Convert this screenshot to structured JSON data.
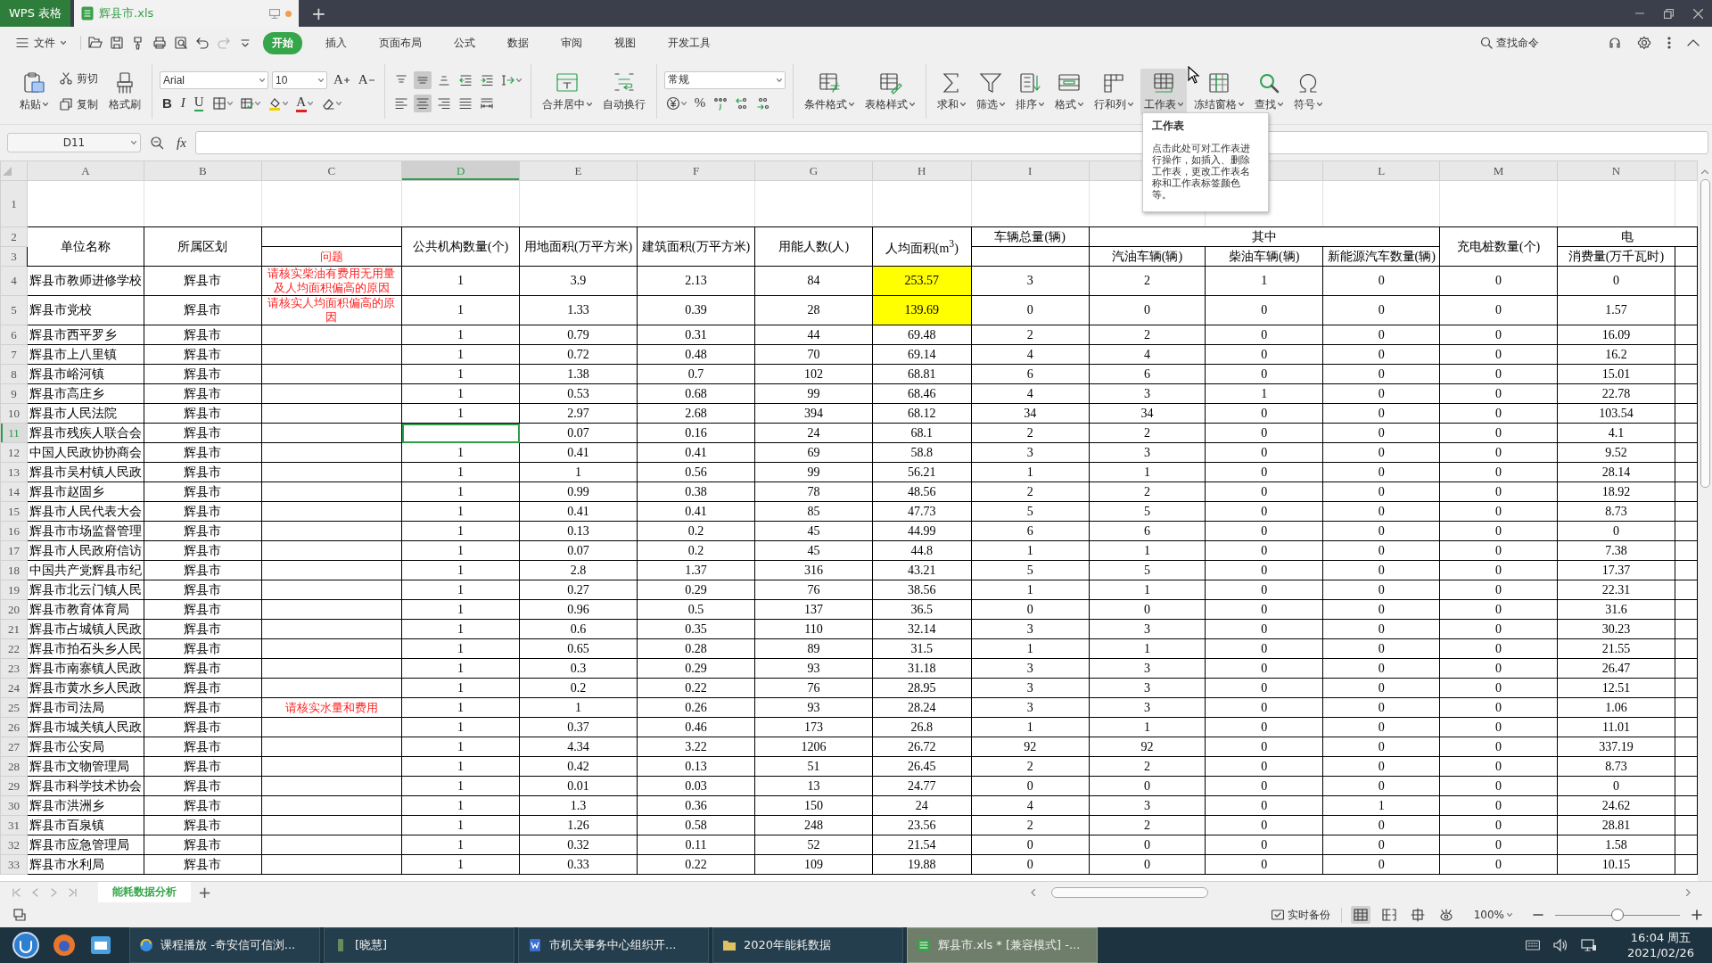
{
  "title_bar": {
    "app": "WPS 表格",
    "tabs": [
      {
        "label": "辉县市.xls",
        "selected": true,
        "unsaved": true
      }
    ],
    "new_tab": "+"
  },
  "menu_bar": {
    "file": "文件",
    "quick_access": [
      {
        "disabled": false
      },
      {
        "disabled": false
      },
      {
        "disabled": false
      },
      {
        "disabled": false
      },
      {
        "disabled": false
      },
      {
        "disabled": false
      },
      {
        "disabled": true
      },
      {
        "disabled": false
      }
    ],
    "tabs": [
      {
        "label": "开始",
        "selected": true
      },
      {
        "label": "插入",
        "selected": false
      },
      {
        "label": "页面布局",
        "selected": false
      },
      {
        "label": "公式",
        "selected": false
      },
      {
        "label": "数据",
        "selected": false
      },
      {
        "label": "审阅",
        "selected": false
      },
      {
        "label": "视图",
        "selected": false
      },
      {
        "label": "开发工具",
        "selected": false
      }
    ],
    "search": "查找命令"
  },
  "ribbon": {
    "groups": [
      {
        "kind": "mixed",
        "items": [
          {
            "kind": "large",
            "label": "粘贴",
            "dropdown": true,
            "hovered": false
          },
          {
            "kind": "small",
            "label": "剪切"
          },
          {
            "kind": "small",
            "label": "复制"
          },
          {
            "kind": "large",
            "label": "格式刷",
            "dropdown": false,
            "hovered": false
          }
        ]
      },
      {
        "kind": "grid",
        "rows": [
          [
            {
              "kind": "select",
              "value": "Arial"
            },
            {
              "kind": "select",
              "value": "10"
            },
            {
              "kind": "glyph",
              "glyph": "A",
              "selected": false,
              "dropdown": false
            },
            {
              "kind": "glyph",
              "glyph": "A",
              "selected": false,
              "dropdown": false
            }
          ],
          [
            {
              "kind": "glyph",
              "glyph": "B",
              "selected": false,
              "dropdown": false
            },
            {
              "kind": "glyph",
              "glyph": "I",
              "selected": false,
              "dropdown": false
            },
            {
              "kind": "glyph",
              "glyph": "U",
              "selected": false,
              "dropdown": false
            },
            {
              "kind": "tool",
              "selected": false,
              "dropdown": true
            },
            {
              "kind": "tool",
              "selected": false,
              "dropdown": true
            },
            {
              "kind": "tool",
              "selected": false,
              "dropdown": true
            },
            {
              "kind": "glyph",
              "glyph": "A",
              "selected": false,
              "dropdown": true
            },
            {
              "kind": "tool",
              "selected": false,
              "dropdown": true
            }
          ]
        ]
      },
      {
        "kind": "grid",
        "rows": [
          [
            {
              "kind": "tool",
              "selected": false,
              "dropdown": false
            },
            {
              "kind": "tool",
              "selected": true,
              "dropdown": false
            },
            {
              "kind": "tool",
              "selected": false,
              "dropdown": false
            },
            {
              "kind": "tool",
              "selected": false,
              "dropdown": false
            },
            {
              "kind": "tool",
              "selected": false,
              "dropdown": false
            },
            {
              "kind": "tool",
              "selected": false,
              "dropdown": true
            }
          ],
          [
            {
              "kind": "tool",
              "selected": false,
              "dropdown": false
            },
            {
              "kind": "tool",
              "selected": true,
              "dropdown": false
            },
            {
              "kind": "tool",
              "selected": false,
              "dropdown": false
            },
            {
              "kind": "tool",
              "selected": false,
              "dropdown": false
            },
            {
              "kind": "tool",
              "selected": false,
              "dropdown": false
            }
          ]
        ]
      },
      {
        "kind": "mixed",
        "items": [
          {
            "kind": "large",
            "label": "合并居中",
            "dropdown": true,
            "hovered": false
          },
          {
            "kind": "large",
            "label": "自动换行",
            "dropdown": false,
            "hovered": false
          }
        ]
      },
      {
        "kind": "grid",
        "rows": [
          [
            {
              "kind": "select",
              "value": "常规"
            }
          ],
          [
            {
              "kind": "tool",
              "selected": false,
              "dropdown": true
            },
            {
              "kind": "glyph",
              "glyph": "%",
              "selected": false,
              "dropdown": false
            },
            {
              "kind": "tool",
              "selected": false,
              "dropdown": false
            },
            {
              "kind": "tool",
              "selected": false,
              "dropdown": false
            },
            {
              "kind": "tool",
              "selected": false,
              "dropdown": false
            }
          ]
        ]
      },
      {
        "kind": "mixed",
        "items": [
          {
            "kind": "large",
            "label": "条件格式",
            "dropdown": true,
            "hovered": false
          },
          {
            "kind": "large",
            "label": "表格样式",
            "dropdown": true,
            "hovered": false
          }
        ]
      },
      {
        "kind": "mixed",
        "items": [
          {
            "kind": "large",
            "label": "求和",
            "dropdown": true,
            "hovered": false
          },
          {
            "kind": "large",
            "label": "筛选",
            "dropdown": true,
            "hovered": false
          },
          {
            "kind": "large",
            "label": "排序",
            "dropdown": true,
            "hovered": false
          },
          {
            "kind": "large",
            "label": "格式",
            "dropdown": true,
            "hovered": false
          },
          {
            "kind": "large",
            "label": "行和列",
            "dropdown": true,
            "hovered": false
          },
          {
            "kind": "large",
            "label": "工作表",
            "dropdown": true,
            "hovered": true
          },
          {
            "kind": "large",
            "label": "冻结窗格",
            "dropdown": true,
            "hovered": false
          },
          {
            "kind": "large",
            "label": "查找",
            "dropdown": true,
            "hovered": false
          },
          {
            "kind": "large",
            "label": "符号",
            "dropdown": true,
            "hovered": false
          }
        ]
      }
    ]
  },
  "tooltip": {
    "title": "工作表",
    "body": "点击此处可对工作表进行操作，如插入、删除工作表，更改工作表名称和工作表标签颜色等。"
  },
  "formula_bar": {
    "name_box": "D11",
    "fx": "fx"
  },
  "sheet": {
    "columns": [
      {
        "letter": "A",
        "selected": false
      },
      {
        "letter": "B",
        "selected": false
      },
      {
        "letter": "C",
        "selected": false
      },
      {
        "letter": "D",
        "selected": true
      },
      {
        "letter": "E",
        "selected": false
      },
      {
        "letter": "F",
        "selected": false
      },
      {
        "letter": "G",
        "selected": false
      },
      {
        "letter": "H",
        "selected": false
      },
      {
        "letter": "I",
        "selected": false
      },
      {
        "selected": false
      },
      {
        "selected": false
      },
      {
        "letter": "L",
        "selected": false
      },
      {
        "letter": "M",
        "selected": false
      },
      {
        "letter": "N",
        "selected": false
      },
      {
        "selected": false
      }
    ],
    "blank_row": {
      "number": "1"
    },
    "header_rows": [
      {
        "number": "2",
        "cells": [
          {
            "text": "单位名称",
            "rowspan": 2
          },
          {
            "text": "所属区划",
            "rowspan": 2
          },
          {},
          {
            "text": "公共机构数量(个)",
            "rowspan": 2
          },
          {
            "text": "用地面积(万平方米)",
            "rowspan": 2
          },
          {
            "text": "建筑面积(万平方米)",
            "rowspan": 2
          },
          {
            "text": "用能人数(人)",
            "rowspan": 2
          },
          {
            "text": "人均面积(m$^{3}$)",
            "rowspan": 2
          },
          {
            "text": "车辆总量(辆)"
          },
          {
            "text": "其中",
            "colspan": 3
          },
          {
            "text": "充电桩数量(个)",
            "rowspan": 2
          },
          {
            "text": "电",
            "colspan": 2
          }
        ]
      },
      {
        "number": "3",
        "cells": [
          {
            "text": "问题",
            "kind": "note"
          },
          {},
          {
            "text": "汽油车辆(辆)"
          },
          {
            "text": "柴油车辆(辆)"
          },
          {
            "text": "新能源汽车数量(辆)"
          },
          {
            "text": "消费量(万千瓦时)"
          },
          {}
        ]
      }
    ],
    "rows": [
      {
        "number": "4",
        "name": "辉县市教师进修学校",
        "district": "辉县市",
        "note": "请核实柴油有费用无用量及人均面积偏高的原因",
        "values": [
          "1",
          "3.9",
          "2.13",
          "84",
          "253.57",
          "3",
          "2",
          "1",
          "0",
          "0",
          "0"
        ],
        "flagged": true,
        "selected": false
      },
      {
        "number": "5",
        "name": "辉县市党校",
        "district": "辉县市",
        "note": "请核实人均面积偏高的原因",
        "values": [
          "1",
          "1.33",
          "0.39",
          "28",
          "139.69",
          "0",
          "0",
          "0",
          "0",
          "0",
          "1.57"
        ],
        "flagged": true,
        "selected": false
      },
      {
        "number": "6",
        "name": "辉县市西平罗乡",
        "district": "辉县市",
        "values": [
          "1",
          "0.79",
          "0.31",
          "44",
          "69.48",
          "2",
          "2",
          "0",
          "0",
          "0",
          "16.09"
        ],
        "flagged": false,
        "selected": false
      },
      {
        "number": "7",
        "name": "辉县市上八里镇",
        "district": "辉县市",
        "values": [
          "1",
          "0.72",
          "0.48",
          "70",
          "69.14",
          "4",
          "4",
          "0",
          "0",
          "0",
          "16.2"
        ],
        "flagged": false,
        "selected": false
      },
      {
        "number": "8",
        "name": "辉县市峪河镇",
        "district": "辉县市",
        "values": [
          "1",
          "1.38",
          "0.7",
          "102",
          "68.81",
          "6",
          "6",
          "0",
          "0",
          "0",
          "15.01"
        ],
        "flagged": false,
        "selected": false
      },
      {
        "number": "9",
        "name": "辉县市高庄乡",
        "district": "辉县市",
        "values": [
          "1",
          "0.53",
          "0.68",
          "99",
          "68.46",
          "4",
          "3",
          "1",
          "0",
          "0",
          "22.78"
        ],
        "flagged": false,
        "selected": false
      },
      {
        "number": "10",
        "name": "辉县市人民法院",
        "district": "辉县市",
        "values": [
          "1",
          "2.97",
          "2.68",
          "394",
          "68.12",
          "34",
          "34",
          "0",
          "0",
          "0",
          "103.54"
        ],
        "flagged": false,
        "selected": false
      },
      {
        "number": "11",
        "name": "辉县市残疾人联合会",
        "district": "辉县市",
        "values": [
          "0.07",
          "0.16",
          "24",
          "68.1",
          "2",
          "2",
          "0",
          "0",
          "0",
          "4.1"
        ],
        "flagged": false,
        "selected": true
      },
      {
        "number": "12",
        "name": "中国人民政协协商会",
        "district": "辉县市",
        "values": [
          "1",
          "0.41",
          "0.41",
          "69",
          "58.8",
          "3",
          "3",
          "0",
          "0",
          "0",
          "9.52"
        ],
        "flagged": false,
        "selected": false
      },
      {
        "number": "13",
        "name": "辉县市吴村镇人民政",
        "district": "辉县市",
        "values": [
          "1",
          "1",
          "0.56",
          "99",
          "56.21",
          "1",
          "1",
          "0",
          "0",
          "0",
          "28.14"
        ],
        "flagged": false,
        "selected": false
      },
      {
        "number": "14",
        "name": "辉县市赵固乡",
        "district": "辉县市",
        "values": [
          "1",
          "0.99",
          "0.38",
          "78",
          "48.56",
          "2",
          "2",
          "0",
          "0",
          "0",
          "18.92"
        ],
        "flagged": false,
        "selected": false
      },
      {
        "number": "15",
        "name": "辉县市人民代表大会",
        "district": "辉县市",
        "values": [
          "1",
          "0.41",
          "0.41",
          "85",
          "47.73",
          "5",
          "5",
          "0",
          "0",
          "0",
          "8.73"
        ],
        "flagged": false,
        "selected": false
      },
      {
        "number": "16",
        "name": "辉县市市场监督管理",
        "district": "辉县市",
        "values": [
          "1",
          "0.13",
          "0.2",
          "45",
          "44.99",
          "6",
          "6",
          "0",
          "0",
          "0",
          "0"
        ],
        "flagged": false,
        "selected": false
      },
      {
        "number": "17",
        "name": "辉县市人民政府信访",
        "district": "辉县市",
        "values": [
          "1",
          "0.07",
          "0.2",
          "45",
          "44.8",
          "1",
          "1",
          "0",
          "0",
          "0",
          "7.38"
        ],
        "flagged": false,
        "selected": false
      },
      {
        "number": "18",
        "name": "中国共产党辉县市纪",
        "district": "辉县市",
        "values": [
          "1",
          "2.8",
          "1.37",
          "316",
          "43.21",
          "5",
          "5",
          "0",
          "0",
          "0",
          "17.37"
        ],
        "flagged": false,
        "selected": false
      },
      {
        "number": "19",
        "name": "辉县市北云门镇人民",
        "district": "辉县市",
        "values": [
          "1",
          "0.27",
          "0.29",
          "76",
          "38.56",
          "1",
          "1",
          "0",
          "0",
          "0",
          "22.31"
        ],
        "flagged": false,
        "selected": false
      },
      {
        "number": "20",
        "name": "辉县市教育体育局",
        "district": "辉县市",
        "values": [
          "1",
          "0.96",
          "0.5",
          "137",
          "36.5",
          "0",
          "0",
          "0",
          "0",
          "0",
          "31.6"
        ],
        "flagged": false,
        "selected": false
      },
      {
        "number": "21",
        "name": "辉县市占城镇人民政",
        "district": "辉县市",
        "values": [
          "1",
          "0.6",
          "0.35",
          "110",
          "32.14",
          "3",
          "3",
          "0",
          "0",
          "0",
          "30.23"
        ],
        "flagged": false,
        "selected": false
      },
      {
        "number": "22",
        "name": "辉县市拍石头乡人民",
        "district": "辉县市",
        "values": [
          "1",
          "0.65",
          "0.28",
          "89",
          "31.5",
          "1",
          "1",
          "0",
          "0",
          "0",
          "21.55"
        ],
        "flagged": false,
        "selected": false
      },
      {
        "number": "23",
        "name": "辉县市南寨镇人民政",
        "district": "辉县市",
        "values": [
          "1",
          "0.3",
          "0.29",
          "93",
          "31.18",
          "3",
          "3",
          "0",
          "0",
          "0",
          "26.47"
        ],
        "flagged": false,
        "selected": false
      },
      {
        "number": "24",
        "name": "辉县市黄水乡人民政",
        "district": "辉县市",
        "values": [
          "1",
          "0.2",
          "0.22",
          "76",
          "28.95",
          "3",
          "3",
          "0",
          "0",
          "0",
          "12.51"
        ],
        "flagged": false,
        "selected": false
      },
      {
        "number": "25",
        "name": "辉县市司法局",
        "district": "辉县市",
        "note": "请核实水量和费用",
        "values": [
          "1",
          "1",
          "0.26",
          "93",
          "28.24",
          "3",
          "3",
          "0",
          "0",
          "0",
          "1.06"
        ],
        "flagged": false,
        "selected": false
      },
      {
        "number": "26",
        "name": "辉县市城关镇人民政",
        "district": "辉县市",
        "values": [
          "1",
          "0.37",
          "0.46",
          "173",
          "26.8",
          "1",
          "1",
          "0",
          "0",
          "0",
          "11.01"
        ],
        "flagged": false,
        "selected": false
      },
      {
        "number": "27",
        "name": "辉县市公安局",
        "district": "辉县市",
        "values": [
          "1",
          "4.34",
          "3.22",
          "1206",
          "26.72",
          "92",
          "92",
          "0",
          "0",
          "0",
          "337.19"
        ],
        "flagged": false,
        "selected": false
      },
      {
        "number": "28",
        "name": "辉县市文物管理局",
        "district": "辉县市",
        "values": [
          "1",
          "0.42",
          "0.13",
          "51",
          "26.45",
          "2",
          "2",
          "0",
          "0",
          "0",
          "8.73"
        ],
        "flagged": false,
        "selected": false
      },
      {
        "number": "29",
        "name": "辉县市科学技术协会",
        "district": "辉县市",
        "values": [
          "1",
          "0.01",
          "0.03",
          "13",
          "24.77",
          "0",
          "0",
          "0",
          "0",
          "0",
          "0"
        ],
        "flagged": false,
        "selected": false
      },
      {
        "number": "30",
        "name": "辉县市洪洲乡",
        "district": "辉县市",
        "values": [
          "1",
          "1.3",
          "0.36",
          "150",
          "24",
          "4",
          "3",
          "0",
          "1",
          "0",
          "24.62"
        ],
        "flagged": false,
        "selected": false
      },
      {
        "number": "31",
        "name": "辉县市百泉镇",
        "district": "辉县市",
        "values": [
          "1",
          "1.26",
          "0.58",
          "248",
          "23.56",
          "2",
          "2",
          "0",
          "0",
          "0",
          "28.81"
        ],
        "flagged": false,
        "selected": false
      },
      {
        "number": "32",
        "name": "辉县市应急管理局",
        "district": "辉县市",
        "values": [
          "1",
          "0.32",
          "0.11",
          "52",
          "21.54",
          "0",
          "0",
          "0",
          "0",
          "0",
          "1.58"
        ],
        "flagged": false,
        "selected": false
      },
      {
        "number": "33",
        "name": "辉县市水利局",
        "district": "辉县市",
        "values": [
          "1",
          "0.33",
          "0.22",
          "109",
          "19.88",
          "0",
          "0",
          "0",
          "0",
          "0",
          "10.15"
        ],
        "flagged": false,
        "selected": false
      }
    ]
  },
  "sheet_tabs": {
    "tabs": [
      {
        "label": "能耗数据分析",
        "selected": true
      }
    ],
    "add": "+"
  },
  "status_bar": {
    "backup": "实时备份",
    "views": [
      {
        "selected": true
      },
      {
        "selected": false
      },
      {
        "selected": false
      },
      {
        "selected": false
      }
    ],
    "zoom": "100%",
    "zoom_slider": {
      "level": 0.5
    }
  },
  "taskbar": {
    "tasks": [
      {
        "label": "课程播放 -奇安信可信浏...",
        "selected": false
      },
      {
        "label": "[晓慧]",
        "selected": false
      },
      {
        "label": "市机关事务中心组织开...",
        "selected": false
      },
      {
        "label": "2020年能耗数据",
        "selected": false
      },
      {
        "label": "辉县市.xls * [兼容模式] -...",
        "selected": true
      }
    ],
    "time": "16:04 周五",
    "date": "2021/02/26"
  }
}
